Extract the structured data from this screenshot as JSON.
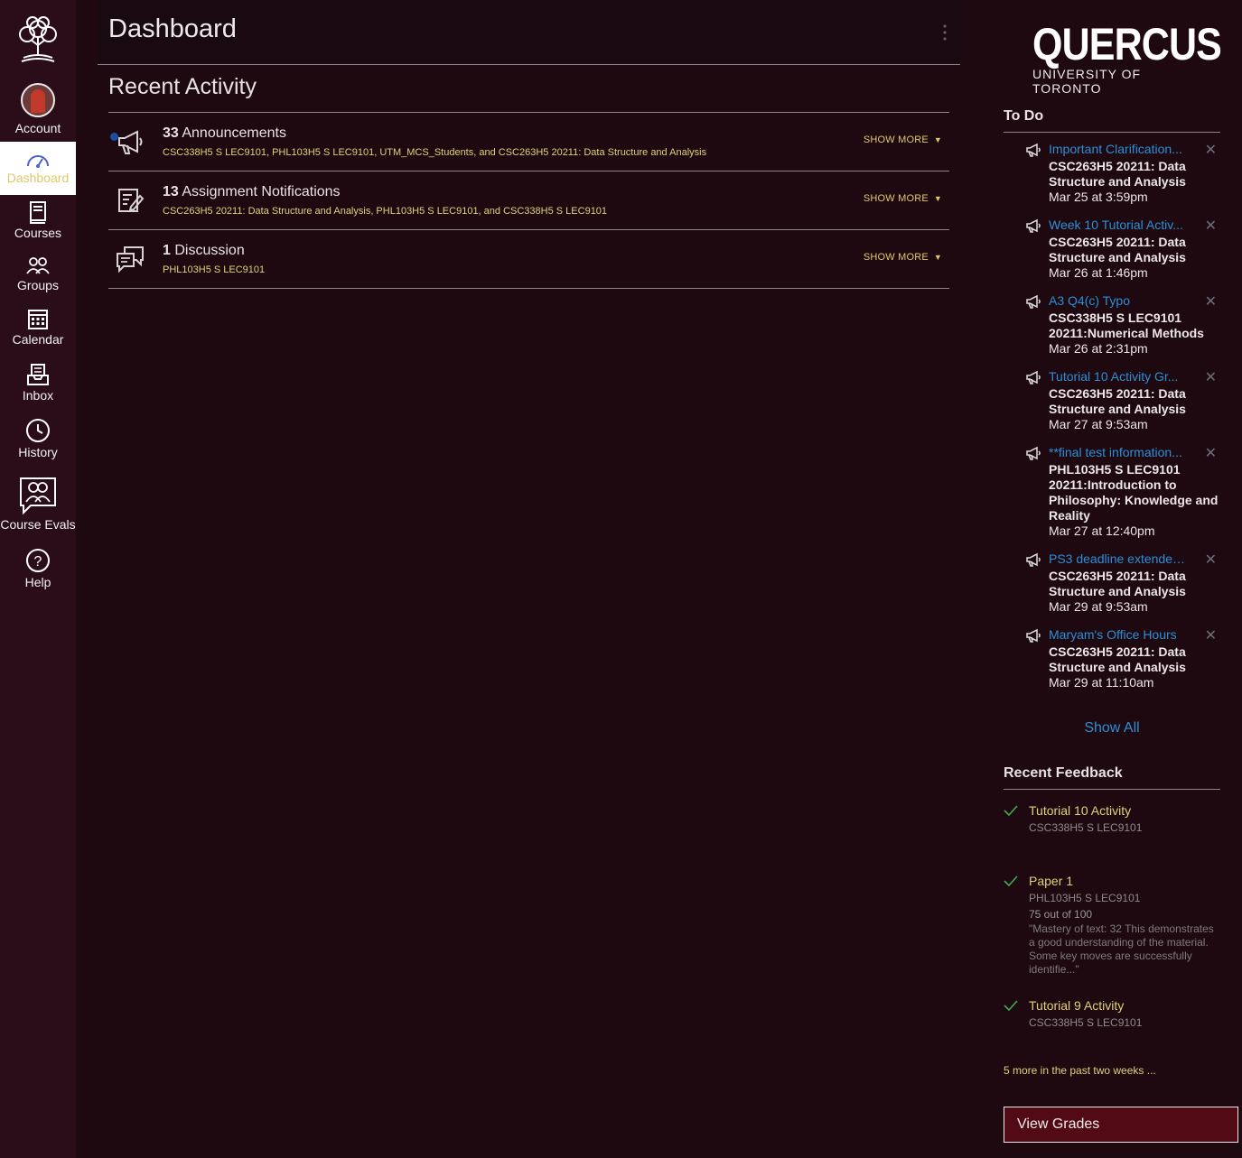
{
  "nav": {
    "account": "Account",
    "dashboard": "Dashboard",
    "courses": "Courses",
    "groups": "Groups",
    "calendar": "Calendar",
    "inbox": "Inbox",
    "history": "History",
    "course_evals": "Course Evals",
    "help": "Help"
  },
  "header": {
    "title": "Dashboard"
  },
  "recent_activity": {
    "title": "Recent Activity",
    "items": [
      {
        "count": "33",
        "label": "Announcements",
        "courses": "CSC338H5 S LEC9101, PHL103H5 S LEC9101, UTM_MCS_Students, and CSC263H5 20211: Data Structure and Analysis",
        "show_more": "SHOW MORE",
        "icon": "megaphone-icon"
      },
      {
        "count": "13",
        "label": "Assignment Notifications",
        "courses": "CSC263H5 20211: Data Structure and Analysis, PHL103H5 S LEC9101, and CSC338H5 S LEC9101",
        "show_more": "SHOW MORE",
        "icon": "assignment-icon"
      },
      {
        "count": "1",
        "label": "Discussion",
        "courses": "PHL103H5 S LEC9101",
        "show_more": "SHOW MORE",
        "icon": "discussion-icon"
      }
    ]
  },
  "brand": {
    "name": "QUERCUS",
    "university": "UNIVERSITY OF TORONTO"
  },
  "todo": {
    "title": "To Do",
    "items": [
      {
        "title": "Important Clarification...",
        "course": "CSC263H5 20211: Data Structure and Analysis",
        "date": "Mar 25 at 3:59pm"
      },
      {
        "title": "Week 10 Tutorial Activ...",
        "course": "CSC263H5 20211: Data Structure and Analysis",
        "date": "Mar 26 at 1:46pm"
      },
      {
        "title": "A3 Q4(c) Typo",
        "course": "CSC338H5 S LEC9101 20211:Numerical Methods",
        "date": "Mar 26 at 2:31pm"
      },
      {
        "title": "Tutorial 10 Activity Gr...",
        "course": "CSC263H5 20211: Data Structure and Analysis",
        "date": "Mar 27 at 9:53am"
      },
      {
        "title": "**final test information...",
        "course": "PHL103H5 S LEC9101 20211:Introduction to Philosophy: Knowledge and Reality",
        "date": "Mar 27 at 12:40pm"
      },
      {
        "title": "PS3 deadline extended...",
        "course": "CSC263H5 20211: Data Structure and Analysis",
        "date": "Mar 29 at 9:53am"
      },
      {
        "title": "Maryam's Office Hours",
        "course": "CSC263H5 20211: Data Structure and Analysis",
        "date": "Mar 29 at 11:10am"
      }
    ],
    "show_all": "Show All"
  },
  "feedback": {
    "title": "Recent Feedback",
    "items": [
      {
        "title": "Tutorial 10 Activity",
        "course": "CSC338H5 S LEC9101",
        "score": "",
        "quote": ""
      },
      {
        "title": "Paper 1",
        "course": "PHL103H5 S LEC9101",
        "score": "75 out of 100",
        "quote": "\"Mastery of text: 32 This demonstrates a good understanding of the material. Some key moves are successfully identifie...\""
      },
      {
        "title": "Tutorial 9 Activity",
        "course": "CSC338H5 S LEC9101",
        "score": "",
        "quote": ""
      }
    ],
    "more": "5 more in the past two weeks ..."
  },
  "view_grades": "View Grades",
  "colors": {
    "accent_link": "#2b8fd8",
    "accent_gold": "#e0d27a",
    "nav_bg": "#2b0d19",
    "button_bg": "#520a14"
  }
}
